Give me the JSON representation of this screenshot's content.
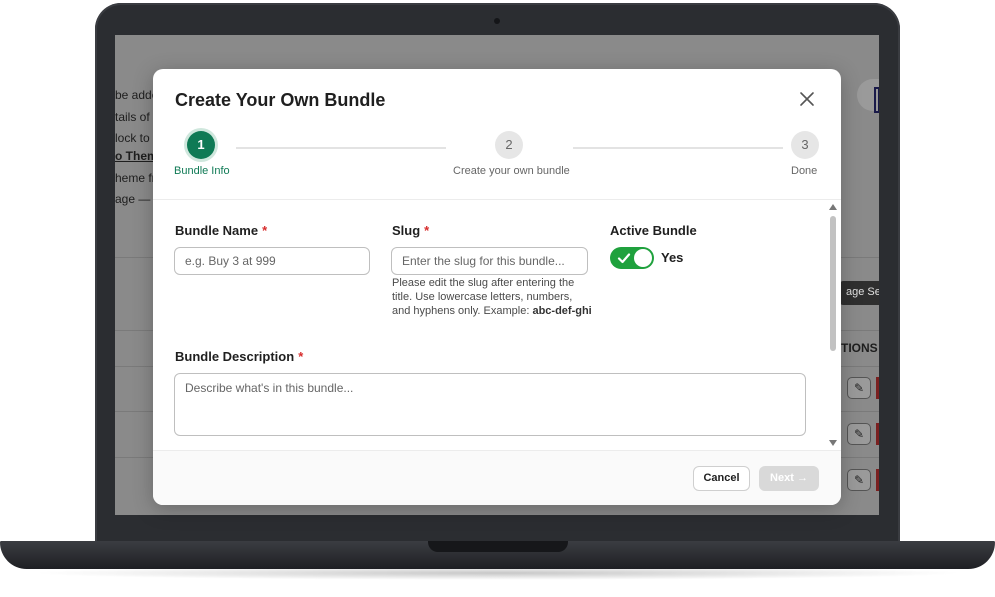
{
  "background": {
    "snippets": [
      "be adde",
      "tails of",
      "lock to",
      "o Them",
      "heme fr",
      "age —"
    ],
    "page_settings_label": "age Set",
    "actions_header": "TIONS",
    "edit_icon": "pencil-icon"
  },
  "modal": {
    "title": "Create Your Own Bundle",
    "close_icon": "close-icon",
    "steps": [
      {
        "number": "1",
        "label": "Bundle Info",
        "state": "active"
      },
      {
        "number": "2",
        "label": "Create your own bundle",
        "state": "inactive"
      },
      {
        "number": "3",
        "label": "Done",
        "state": "inactive"
      }
    ],
    "fields": {
      "bundle_name": {
        "label": "Bundle Name",
        "required_mark": "*",
        "placeholder": "e.g. Buy 3 at 999",
        "value": ""
      },
      "slug": {
        "label": "Slug",
        "required_mark": "*",
        "placeholder": "Enter the slug for this bundle...",
        "value": "",
        "help_text": "Please edit the slug after entering the title. Use lowercase letters, numbers, and hyphens only. Example:",
        "help_example": "abc-def-ghi"
      },
      "active_bundle": {
        "label": "Active Bundle",
        "state_label": "Yes",
        "on": true
      },
      "description": {
        "label": "Bundle Description",
        "required_mark": "*",
        "placeholder": "Describe what's in this bundle...",
        "value": ""
      }
    },
    "footer": {
      "cancel_label": "Cancel",
      "next_label": "Next →"
    }
  },
  "colors": {
    "accent": "#0f7a55",
    "toggle_on": "#1fa13d",
    "required": "#d72c2c",
    "disabled_button": "#d9d9d9"
  }
}
